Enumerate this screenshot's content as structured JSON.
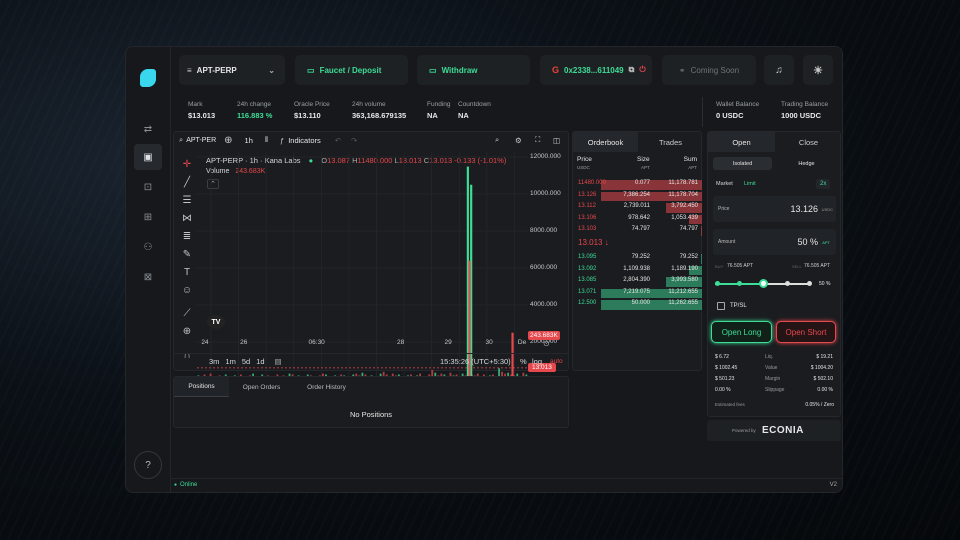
{
  "topbar": {
    "pair": "APT-PERP",
    "faucet": "Faucet / Deposit",
    "withdraw": "Withdraw",
    "wallet": "0x2338...611049",
    "coming_soon": "Coming Soon"
  },
  "stats": [
    {
      "label": "Mark",
      "value": "$13.013"
    },
    {
      "label": "24h change",
      "value": "116.883 %",
      "green": true
    },
    {
      "label": "Oracle Price",
      "value": "$13.110"
    },
    {
      "label": "24h volume",
      "value": "363,168.679135"
    },
    {
      "label": "Funding",
      "value": "NA"
    },
    {
      "label": "Countdown",
      "value": "NA"
    },
    {
      "label": "Wallet Balance",
      "value": "0 USDC"
    },
    {
      "label": "Trading Balance",
      "value": "1000 USDC"
    }
  ],
  "chart_toolbar": {
    "symbol": "APT-PER",
    "interval": "1h",
    "indicators": "Indicators"
  },
  "chart_legend": {
    "title": "APT-PERP · 1h · Kana Labs",
    "o": "13.087",
    "h": "11480.000",
    "l": "13.013",
    "c": "13.013",
    "chg": "-0.133 (-1.01%)",
    "vol_label": "Volume",
    "vol_value": "243.683K"
  },
  "chart_data": {
    "type": "bar",
    "x_ticks": [
      "24",
      "26",
      "06:30",
      "28",
      "29",
      "30",
      "De"
    ],
    "y_ticks": [
      "12000.000",
      "10000.000",
      "8000.000",
      "6000.000",
      "4000.000",
      "2000.000"
    ],
    "ylim": [
      0,
      12000
    ],
    "price_tag": "13.013",
    "volume_tag": "243.683K",
    "volume_bars": [
      0.04,
      0.03,
      0.05,
      0.02,
      0.06,
      0.03,
      0.02,
      0.04,
      0.03,
      0.05,
      0.02,
      0.03,
      0.04,
      0.02,
      0.05,
      0.03,
      0.02,
      0.04,
      0.06,
      0.03,
      0.02,
      0.05,
      0.03,
      0.04,
      0.02,
      0.03,
      0.05,
      0.02,
      0.04,
      0.03,
      0.06,
      0.05,
      0.03,
      0.04,
      0.02,
      0.03,
      0.05,
      0.04,
      0.02,
      0.03,
      0.04,
      0.06,
      0.05,
      0.03,
      0.02,
      0.04,
      0.03,
      0.05,
      0.04,
      0.02,
      0.03,
      0.05,
      0.06,
      0.04,
      0.07,
      0.05,
      0.03,
      0.04,
      0.02,
      0.03,
      0.06,
      0.08,
      0.05,
      0.03,
      0.06,
      0.04,
      0.05,
      0.03,
      0.02,
      0.04,
      0.05,
      0.03,
      0.04,
      0.06,
      0.03,
      0.02,
      0.05,
      0.1,
      0.07,
      0.04,
      0.06,
      0.05,
      0.03,
      0.07,
      0.04,
      0.05,
      0.03,
      0.06,
      0.04,
      0.2,
      0.05,
      0.04,
      0.06,
      0.03,
      0.05,
      0.02,
      0.04,
      0.05,
      0.03,
      0.12,
      0.08,
      0.06,
      0.07,
      0.05,
      0.04,
      0.06,
      0.03,
      0.07,
      0.05
    ],
    "spikes": [
      {
        "pos": 0.815,
        "value": 11480,
        "color": "green"
      },
      {
        "pos": 0.825,
        "value": 10500,
        "color": "green"
      },
      {
        "pos": 0.82,
        "value": 6400,
        "color": "red"
      },
      {
        "pos": 0.95,
        "value": 2500,
        "color": "red"
      }
    ]
  },
  "chart_footer": {
    "ranges": [
      "3m",
      "1m",
      "5d",
      "1d"
    ],
    "time": "15:35:26 (UTC+5:30)",
    "pct": "%",
    "log": "log",
    "auto": "auto"
  },
  "tabs_bottom": {
    "positions": "Positions",
    "open_orders": "Open Orders",
    "order_history": "Order History",
    "empty": "No Positions"
  },
  "orderbook": {
    "tab_ob": "Orderbook",
    "tab_trades": "Trades",
    "h_price": "Price",
    "h_size": "Size",
    "h_sum": "Sum",
    "u_price": "USDC",
    "u_size": "APT",
    "u_sum": "APT",
    "asks": [
      {
        "price": "11480.000",
        "size": "0.077",
        "sum": "11,178.781",
        "depth": 0.78
      },
      {
        "price": "13.126",
        "size": "7,386.254",
        "sum": "11,178.704",
        "depth": 0.78
      },
      {
        "price": "13.112",
        "size": "2,739.011",
        "sum": "3,792.450",
        "depth": 0.28
      },
      {
        "price": "13.106",
        "size": "978.642",
        "sum": "1,053.439",
        "depth": 0.1
      },
      {
        "price": "13.103",
        "size": "74.797",
        "sum": "74.797",
        "depth": 0.01
      }
    ],
    "mid": "13.013 ↓",
    "bids": [
      {
        "price": "13.095",
        "size": "79.252",
        "sum": "79.252",
        "depth": 0.01
      },
      {
        "price": "13.092",
        "size": "1,109.938",
        "sum": "1,189.190",
        "depth": 0.1
      },
      {
        "price": "13.085",
        "size": "2,804.390",
        "sum": "3,993.580",
        "depth": 0.28
      },
      {
        "price": "13.071",
        "size": "7,219.075",
        "sum": "11,212.655",
        "depth": 0.78
      },
      {
        "price": "12.500",
        "size": "50.000",
        "sum": "11,262.655",
        "depth": 0.78
      }
    ]
  },
  "trade": {
    "tab_open": "Open",
    "tab_close": "Close",
    "isolated": "Isolated",
    "hedge": "Hedge",
    "market": "Market",
    "limit": "Limit",
    "leverage": "2x",
    "price_label": "Price",
    "price_value": "13.126",
    "price_unit": "USDC",
    "amount_label": "Amount",
    "amount_value": "50 %",
    "amount_unit": "APT",
    "slider_left_label": "BUY",
    "slider_left": "76.505 APT",
    "slider_right_label": "SELL",
    "slider_right": "76.505 APT",
    "slider_pct": "50 %",
    "slider_level": 0.5,
    "tpsl": "TP/SL",
    "open_long": "Open Long",
    "open_short": "Open Short",
    "rows": [
      {
        "l": "$ 6.72",
        "m": "Liq.",
        "r": "$ 19.21"
      },
      {
        "l": "$ 1002.45",
        "m": "Value",
        "r": "$ 1004.20"
      },
      {
        "l": "$ 501.23",
        "m": "Margin",
        "r": "$ 502.10"
      },
      {
        "l": "0.00 %",
        "m": "Slippage",
        "r": "0.00 %"
      }
    ],
    "fees_label": "Estimated fees",
    "fees_value": "0.05% / Zero",
    "powered": "Powered by",
    "brand": "ECONIA"
  },
  "status": {
    "online": "Online",
    "version": "V2"
  },
  "colors": {
    "green": "#3ddc97",
    "red": "#e5484d",
    "accent": "#38d7ee"
  }
}
